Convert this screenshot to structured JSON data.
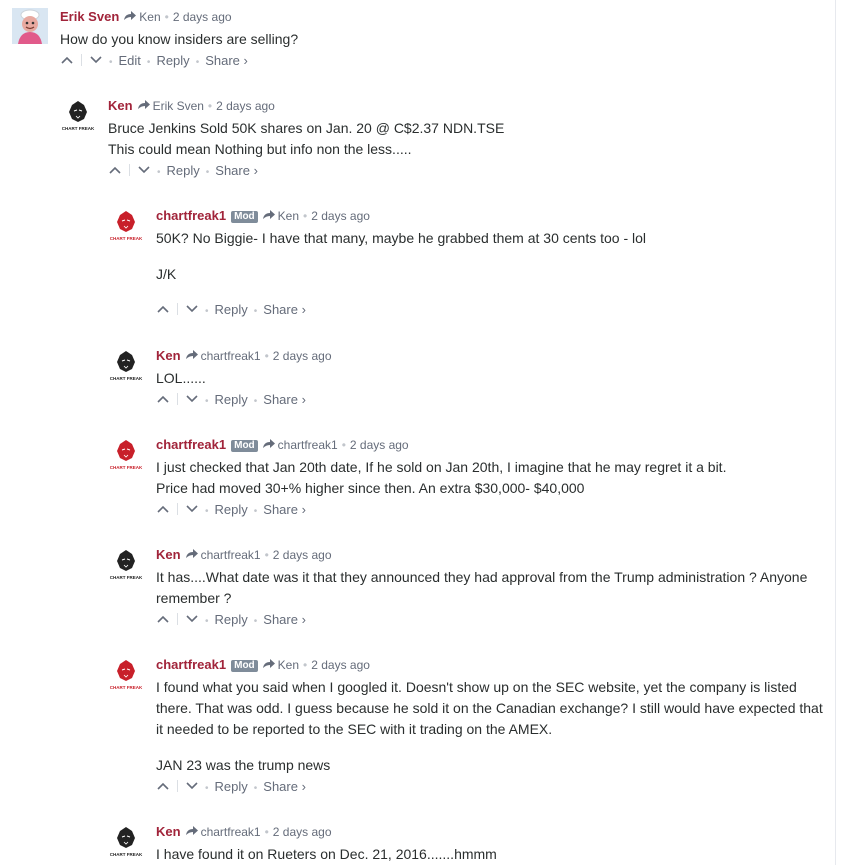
{
  "thread": {
    "comments": [
      {
        "author": "Erik Sven",
        "mod_badge": "",
        "reply_to": "Ken",
        "time": "2 days ago",
        "text": [
          "How do you know insiders are selling?"
        ],
        "actions": {
          "edit": "Edit",
          "reply": "Reply",
          "share": "Share ›"
        },
        "avatar_icon": "chef-character-avatar"
      },
      {
        "author": "Ken",
        "mod_badge": "",
        "reply_to": "Erik Sven",
        "time": "2 days ago",
        "text": [
          "Bruce Jenkins Sold 50K shares on Jan. 20 @ C$2.37 NDN.TSE",
          "This could mean Nothing but info non the less....."
        ],
        "actions": {
          "reply": "Reply",
          "share": "Share ›"
        },
        "avatar_icon": "black-lion-logo-avatar",
        "avatar_caption": "CHART FREAK"
      },
      {
        "author": "chartfreak1",
        "mod_badge": "Mod",
        "reply_to": "Ken",
        "time": "2 days ago",
        "text": [
          "50K? No Biggie- I have that many, maybe he grabbed them at 30 cents too - lol",
          "J/K"
        ],
        "actions": {
          "reply": "Reply",
          "share": "Share ›"
        },
        "avatar_icon": "red-lion-logo-avatar",
        "avatar_caption": "CHART FREAK"
      },
      {
        "author": "Ken",
        "mod_badge": "",
        "reply_to": "chartfreak1",
        "time": "2 days ago",
        "text": [
          "LOL......"
        ],
        "actions": {
          "reply": "Reply",
          "share": "Share ›"
        },
        "avatar_icon": "black-lion-logo-avatar",
        "avatar_caption": "CHART FREAK"
      },
      {
        "author": "chartfreak1",
        "mod_badge": "Mod",
        "reply_to": "chartfreak1",
        "time": "2 days ago",
        "text": [
          "I just checked that Jan 20th date, If he sold on Jan 20th, I imagine that he may regret it a bit.",
          "Price had moved 30+% higher since then. An extra $30,000- $40,000"
        ],
        "actions": {
          "reply": "Reply",
          "share": "Share ›"
        },
        "avatar_icon": "red-lion-logo-avatar",
        "avatar_caption": "CHART FREAK"
      },
      {
        "author": "Ken",
        "mod_badge": "",
        "reply_to": "chartfreak1",
        "time": "2 days ago",
        "text": [
          "It has....What date was it that they announced they had approval from the Trump administration ? Anyone remember ?"
        ],
        "actions": {
          "reply": "Reply",
          "share": "Share ›"
        },
        "avatar_icon": "black-lion-logo-avatar",
        "avatar_caption": "CHART FREAK"
      },
      {
        "author": "chartfreak1",
        "mod_badge": "Mod",
        "reply_to": "Ken",
        "time": "2 days ago",
        "text": [
          "I found what you said when I googled it. Doesn't show up on the SEC website, yet the company is listed there. That was odd. I guess because he sold it on the Canadian exchange? I still would have expected that it needed to be reported to the SEC with it trading on the AMEX.",
          "JAN 23 was the trump news"
        ],
        "actions": {
          "reply": "Reply",
          "share": "Share ›"
        },
        "avatar_icon": "red-lion-logo-avatar",
        "avatar_caption": "CHART FREAK"
      },
      {
        "author": "Ken",
        "mod_badge": "",
        "reply_to": "chartfreak1",
        "time": "2 days ago",
        "text": [
          "I have found it on Rueters on Dec. 21, 2016.......hmmm"
        ],
        "actions": {},
        "avatar_icon": "black-lion-logo-avatar",
        "avatar_caption": "CHART FREAK"
      }
    ]
  },
  "colors": {
    "author": "#a1243a",
    "meta": "#656c7a",
    "mod_badge_bg": "#7f8c9a",
    "text": "#2a2e2e",
    "rail": "#e7e9ee"
  }
}
